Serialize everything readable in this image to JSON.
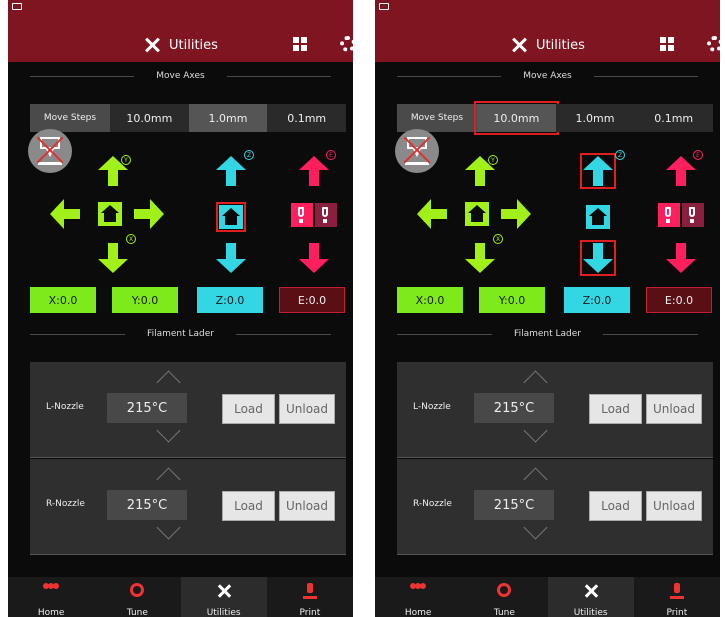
{
  "header": {
    "title": "Utilities"
  },
  "move_axes": {
    "section_title": "Move Axes",
    "steps_label": "Move Steps",
    "step_options": [
      "10.0mm",
      "1.0mm",
      "0.1mm"
    ]
  },
  "axis_letters": {
    "x": "X",
    "y": "Y",
    "z": "Z",
    "e": "E"
  },
  "panels": [
    {
      "selected_step": "1.0mm",
      "highlighted_controls": [
        "z-home-button"
      ],
      "positions": {
        "x": "X:0.0",
        "y": "Y:0.0",
        "z": "Z:0.0",
        "e": "E:0.0"
      }
    },
    {
      "selected_step": "10.0mm",
      "highlighted_controls": [
        "step-option-10mm",
        "z-up-arrow",
        "z-down-arrow"
      ],
      "positions": {
        "x": "X:0.0",
        "y": "Y:0.0",
        "z": "Z:0.0",
        "e": "E:0.0"
      }
    }
  ],
  "filament": {
    "section_title": "Filament Lader",
    "nozzles": [
      {
        "label": "L-Nozzle",
        "temp": "215°C"
      },
      {
        "label": "R-Nozzle",
        "temp": "215°C"
      }
    ],
    "load_label": "Load",
    "unload_label": "Unload"
  },
  "tabs": [
    {
      "label": "Home",
      "icon": "people-icon"
    },
    {
      "label": "Tune",
      "icon": "tune-icon"
    },
    {
      "label": "Utilities",
      "icon": "utilities-icon",
      "active": true
    },
    {
      "label": "Print",
      "icon": "print-icon"
    }
  ],
  "colors": {
    "header_bg": "#7e1520",
    "xy_green": "#7fea1a",
    "z_cyan": "#33d6e3",
    "e_pink": "#ff1f5e",
    "highlight": "#e02020"
  }
}
